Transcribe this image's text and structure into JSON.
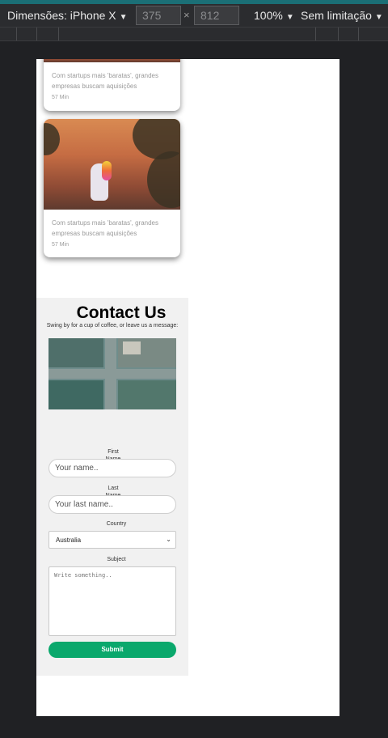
{
  "devtools": {
    "device_label": "Dimensões: iPhone X",
    "width": "375",
    "times": "×",
    "height": "812",
    "zoom": "100%",
    "throttling": "Sem limitação"
  },
  "cards": [
    {
      "desc": "Com startups mais 'baratas', grandes empresas buscam aquisições",
      "time": "57 Min"
    },
    {
      "desc": "Com startups mais 'baratas', grandes empresas buscam aquisições",
      "time": "57 Min"
    }
  ],
  "contact": {
    "title": "Contact Us",
    "subtitle": "Swing by for a cup of coffee, or leave us a message:",
    "first_name_label": "First Name",
    "first_name_placeholder": "Your name..",
    "last_name_label": "Last Name",
    "last_name_placeholder": "Your last name..",
    "country_label": "Country",
    "country_value": "Australia",
    "subject_label": "Subject",
    "subject_placeholder": "Write something..",
    "submit_label": "Submit"
  },
  "colors": {
    "accent": "#0aa86c",
    "devtools_bg": "#2b2c2f",
    "page_bg": "#202124"
  }
}
